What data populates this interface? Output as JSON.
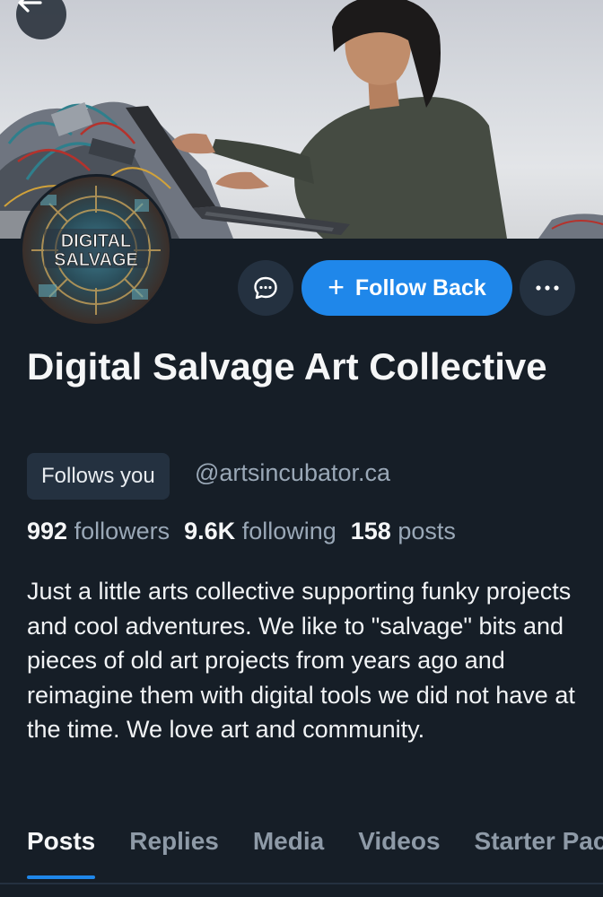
{
  "profile": {
    "display_name": "Digital Salvage Art Collective",
    "handle": "@artsincubator.ca",
    "follows_you_badge": "Follows you",
    "bio": "Just a little arts collective supporting funky projects and cool adventures. We like to \"salvage\" bits and pieces of old art projects from years ago and reimagine them with digital tools we did not have at the time. We love art and community.",
    "avatar_logo_text": "DIGITAL SALVAGE"
  },
  "stats": {
    "followers_count": "992",
    "followers_label": "followers",
    "following_count": "9.6K",
    "following_label": "following",
    "posts_count": "158",
    "posts_label": "posts"
  },
  "actions": {
    "message_icon": "chat-bubble-icon",
    "follow_plus": "+",
    "follow_label": "Follow Back",
    "more_icon": "ellipsis-icon",
    "back_icon": "arrow-left-icon"
  },
  "tabs": [
    {
      "label": "Posts",
      "active": true
    },
    {
      "label": "Replies",
      "active": false
    },
    {
      "label": "Media",
      "active": false
    },
    {
      "label": "Videos",
      "active": false
    },
    {
      "label": "Starter Packs",
      "active": false
    }
  ],
  "colors": {
    "background": "#161e27",
    "accent": "#1f87ea",
    "secondary_text": "#9aa8b7",
    "chip_background": "#243140"
  }
}
